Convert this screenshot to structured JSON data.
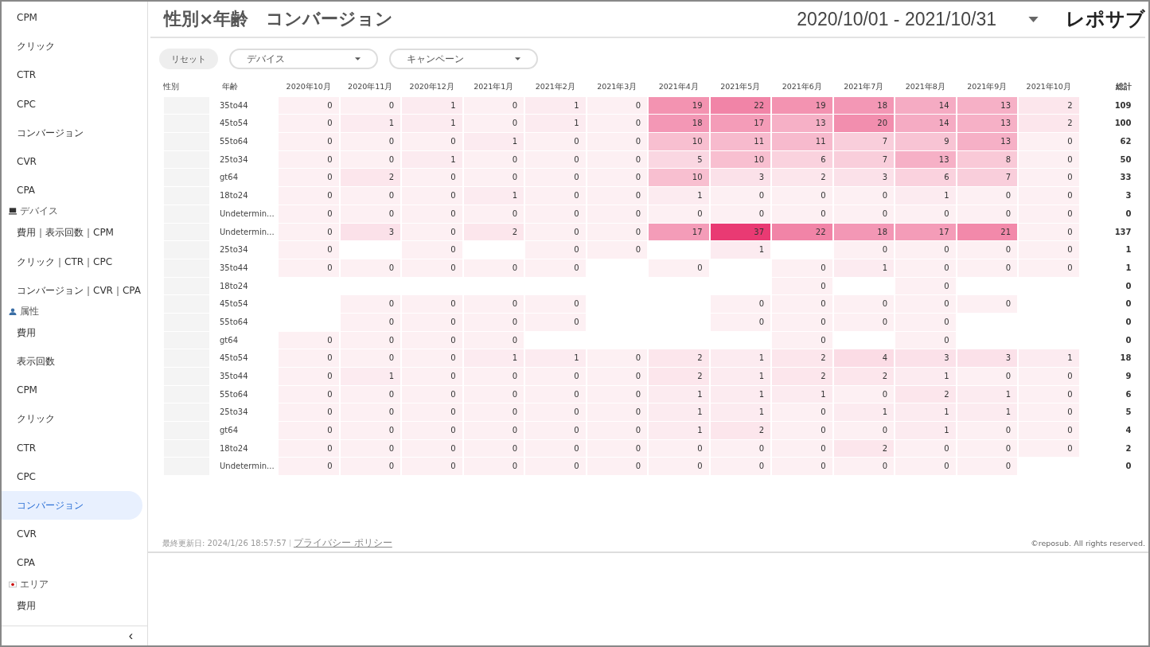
{
  "sidebar": {
    "entries": [
      {
        "kind": "item",
        "label": "CPM",
        "selected": false
      },
      {
        "kind": "item",
        "label": "クリック",
        "selected": false
      },
      {
        "kind": "item",
        "label": "CTR",
        "selected": false
      },
      {
        "kind": "item",
        "label": "CPC",
        "selected": false
      },
      {
        "kind": "item",
        "label": "コンバージョン",
        "selected": false
      },
      {
        "kind": "item",
        "label": "CVR",
        "selected": false
      },
      {
        "kind": "item",
        "label": "CPA",
        "selected": false
      },
      {
        "kind": "header",
        "label": "デバイス"
      },
      {
        "kind": "item",
        "label": "費用｜表示回数｜CPM",
        "selected": false
      },
      {
        "kind": "item",
        "label": "クリック｜CTR｜CPC",
        "selected": false
      },
      {
        "kind": "item",
        "label": "コンバージョン｜CVR｜CPA",
        "selected": false
      },
      {
        "kind": "header",
        "label": "属性"
      },
      {
        "kind": "item",
        "label": "費用",
        "selected": false
      },
      {
        "kind": "item",
        "label": "表示回数",
        "selected": false
      },
      {
        "kind": "item",
        "label": "CPM",
        "selected": false
      },
      {
        "kind": "item",
        "label": "クリック",
        "selected": false
      },
      {
        "kind": "item",
        "label": "CTR",
        "selected": false
      },
      {
        "kind": "item",
        "label": "CPC",
        "selected": false
      },
      {
        "kind": "item",
        "label": "コンバージョン",
        "selected": true
      },
      {
        "kind": "item",
        "label": "CVR",
        "selected": false
      },
      {
        "kind": "item",
        "label": "CPA",
        "selected": false
      },
      {
        "kind": "header",
        "label": "エリア"
      },
      {
        "kind": "item",
        "label": "費用",
        "selected": false
      }
    ],
    "collapse": "‹"
  },
  "header": {
    "title": "性別×年齢　コンバージョン",
    "date_range": "2020/10/01 - 2021/10/31",
    "logo": "レポサブ"
  },
  "filters": {
    "reset": "リセット",
    "dropdowns": [
      {
        "label": "デバイス"
      },
      {
        "label": "キャンペーン"
      }
    ]
  },
  "table": {
    "columns": [
      "性別",
      "年齢",
      "2020年10月",
      "2020年11月",
      "2020年12月",
      "2021年1月",
      "2021年2月",
      "2021年3月",
      "2021年4月",
      "2021年5月",
      "2021年6月",
      "2021年7月",
      "2021年8月",
      "2021年9月",
      "2021年10月",
      "総計"
    ],
    "rows": [
      {
        "age": "35to44",
        "total": "109",
        "cells": [
          {
            "kind": "value",
            "value": "0"
          },
          {
            "kind": "value",
            "value": "0"
          },
          {
            "kind": "value",
            "value": "1"
          },
          {
            "kind": "value",
            "value": "0"
          },
          {
            "kind": "value",
            "value": "1"
          },
          {
            "kind": "value",
            "value": "0"
          },
          {
            "kind": "value",
            "value": "19"
          },
          {
            "kind": "value",
            "value": "22"
          },
          {
            "kind": "value",
            "value": "19"
          },
          {
            "kind": "value",
            "value": "18"
          },
          {
            "kind": "value",
            "value": "14"
          },
          {
            "kind": "value",
            "value": "13"
          },
          {
            "kind": "value",
            "value": "2"
          }
        ]
      },
      {
        "age": "45to54",
        "total": "100",
        "cells": [
          {
            "kind": "value",
            "value": "0"
          },
          {
            "kind": "value",
            "value": "1"
          },
          {
            "kind": "value",
            "value": "1"
          },
          {
            "kind": "value",
            "value": "0"
          },
          {
            "kind": "value",
            "value": "1"
          },
          {
            "kind": "value",
            "value": "0"
          },
          {
            "kind": "value",
            "value": "18"
          },
          {
            "kind": "value",
            "value": "17"
          },
          {
            "kind": "value",
            "value": "13"
          },
          {
            "kind": "value",
            "value": "20"
          },
          {
            "kind": "value",
            "value": "14"
          },
          {
            "kind": "value",
            "value": "13"
          },
          {
            "kind": "value",
            "value": "2"
          }
        ]
      },
      {
        "age": "55to64",
        "total": "62",
        "cells": [
          {
            "kind": "value",
            "value": "0"
          },
          {
            "kind": "value",
            "value": "0"
          },
          {
            "kind": "value",
            "value": "0"
          },
          {
            "kind": "value",
            "value": "1"
          },
          {
            "kind": "value",
            "value": "0"
          },
          {
            "kind": "value",
            "value": "0"
          },
          {
            "kind": "value",
            "value": "10"
          },
          {
            "kind": "value",
            "value": "11"
          },
          {
            "kind": "value",
            "value": "11"
          },
          {
            "kind": "value",
            "value": "7"
          },
          {
            "kind": "value",
            "value": "9"
          },
          {
            "kind": "value",
            "value": "13"
          },
          {
            "kind": "value",
            "value": "0"
          }
        ]
      },
      {
        "age": "25to34",
        "total": "50",
        "cells": [
          {
            "kind": "value",
            "value": "0"
          },
          {
            "kind": "value",
            "value": "0"
          },
          {
            "kind": "value",
            "value": "1"
          },
          {
            "kind": "value",
            "value": "0"
          },
          {
            "kind": "value",
            "value": "0"
          },
          {
            "kind": "value",
            "value": "0"
          },
          {
            "kind": "value",
            "value": "5"
          },
          {
            "kind": "value",
            "value": "10"
          },
          {
            "kind": "value",
            "value": "6"
          },
          {
            "kind": "value",
            "value": "7"
          },
          {
            "kind": "value",
            "value": "13"
          },
          {
            "kind": "value",
            "value": "8"
          },
          {
            "kind": "value",
            "value": "0"
          }
        ]
      },
      {
        "age": "gt64",
        "total": "33",
        "cells": [
          {
            "kind": "value",
            "value": "0"
          },
          {
            "kind": "value",
            "value": "2"
          },
          {
            "kind": "value",
            "value": "0"
          },
          {
            "kind": "value",
            "value": "0"
          },
          {
            "kind": "value",
            "value": "0"
          },
          {
            "kind": "value",
            "value": "0"
          },
          {
            "kind": "value",
            "value": "10"
          },
          {
            "kind": "value",
            "value": "3"
          },
          {
            "kind": "value",
            "value": "2"
          },
          {
            "kind": "value",
            "value": "3"
          },
          {
            "kind": "value",
            "value": "6"
          },
          {
            "kind": "value",
            "value": "7"
          },
          {
            "kind": "value",
            "value": "0"
          }
        ]
      },
      {
        "age": "18to24",
        "total": "3",
        "cells": [
          {
            "kind": "value",
            "value": "0"
          },
          {
            "kind": "value",
            "value": "0"
          },
          {
            "kind": "value",
            "value": "0"
          },
          {
            "kind": "value",
            "value": "1"
          },
          {
            "kind": "value",
            "value": "0"
          },
          {
            "kind": "value",
            "value": "0"
          },
          {
            "kind": "value",
            "value": "1"
          },
          {
            "kind": "value",
            "value": "0"
          },
          {
            "kind": "value",
            "value": "0"
          },
          {
            "kind": "value",
            "value": "0"
          },
          {
            "kind": "value",
            "value": "1"
          },
          {
            "kind": "value",
            "value": "0"
          },
          {
            "kind": "value",
            "value": "0"
          }
        ]
      },
      {
        "age": "Undetermin...",
        "total": "0",
        "cells": [
          {
            "kind": "value",
            "value": "0"
          },
          {
            "kind": "value",
            "value": "0"
          },
          {
            "kind": "value",
            "value": "0"
          },
          {
            "kind": "value",
            "value": "0"
          },
          {
            "kind": "value",
            "value": "0"
          },
          {
            "kind": "value",
            "value": "0"
          },
          {
            "kind": "value",
            "value": "0"
          },
          {
            "kind": "value",
            "value": "0"
          },
          {
            "kind": "value",
            "value": "0"
          },
          {
            "kind": "value",
            "value": "0"
          },
          {
            "kind": "value",
            "value": "0"
          },
          {
            "kind": "value",
            "value": "0"
          },
          {
            "kind": "value",
            "value": "0"
          }
        ]
      },
      {
        "age": "Undetermin...",
        "total": "137",
        "cells": [
          {
            "kind": "value",
            "value": "0"
          },
          {
            "kind": "value",
            "value": "3"
          },
          {
            "kind": "value",
            "value": "0"
          },
          {
            "kind": "value",
            "value": "2"
          },
          {
            "kind": "value",
            "value": "0"
          },
          {
            "kind": "value",
            "value": "0"
          },
          {
            "kind": "value",
            "value": "17"
          },
          {
            "kind": "value",
            "value": "37"
          },
          {
            "kind": "value",
            "value": "22"
          },
          {
            "kind": "value",
            "value": "18"
          },
          {
            "kind": "value",
            "value": "17"
          },
          {
            "kind": "value",
            "value": "21"
          },
          {
            "kind": "value",
            "value": "0"
          }
        ]
      },
      {
        "age": "25to34",
        "total": "1",
        "cells": [
          {
            "kind": "value",
            "value": "0"
          },
          {
            "kind": "empty"
          },
          {
            "kind": "value",
            "value": "0"
          },
          {
            "kind": "empty"
          },
          {
            "kind": "value",
            "value": "0"
          },
          {
            "kind": "value",
            "value": "0"
          },
          {
            "kind": "empty"
          },
          {
            "kind": "value",
            "value": "1"
          },
          {
            "kind": "empty"
          },
          {
            "kind": "value",
            "value": "0"
          },
          {
            "kind": "value",
            "value": "0"
          },
          {
            "kind": "value",
            "value": "0"
          },
          {
            "kind": "value",
            "value": "0"
          }
        ]
      },
      {
        "age": "35to44",
        "total": "1",
        "cells": [
          {
            "kind": "value",
            "value": "0"
          },
          {
            "kind": "value",
            "value": "0"
          },
          {
            "kind": "value",
            "value": "0"
          },
          {
            "kind": "value",
            "value": "0"
          },
          {
            "kind": "value",
            "value": "0"
          },
          {
            "kind": "empty"
          },
          {
            "kind": "value",
            "value": "0"
          },
          {
            "kind": "empty"
          },
          {
            "kind": "value",
            "value": "0"
          },
          {
            "kind": "value",
            "value": "1"
          },
          {
            "kind": "value",
            "value": "0"
          },
          {
            "kind": "value",
            "value": "0"
          },
          {
            "kind": "value",
            "value": "0"
          }
        ]
      },
      {
        "age": "18to24",
        "total": "0",
        "cells": [
          {
            "kind": "empty"
          },
          {
            "kind": "empty"
          },
          {
            "kind": "empty"
          },
          {
            "kind": "empty"
          },
          {
            "kind": "empty"
          },
          {
            "kind": "empty"
          },
          {
            "kind": "empty"
          },
          {
            "kind": "empty"
          },
          {
            "kind": "value",
            "value": "0"
          },
          {
            "kind": "empty"
          },
          {
            "kind": "value",
            "value": "0"
          },
          {
            "kind": "empty"
          },
          {
            "kind": "empty"
          }
        ]
      },
      {
        "age": "45to54",
        "total": "0",
        "cells": [
          {
            "kind": "empty"
          },
          {
            "kind": "value",
            "value": "0"
          },
          {
            "kind": "value",
            "value": "0"
          },
          {
            "kind": "value",
            "value": "0"
          },
          {
            "kind": "value",
            "value": "0"
          },
          {
            "kind": "empty"
          },
          {
            "kind": "empty"
          },
          {
            "kind": "value",
            "value": "0"
          },
          {
            "kind": "value",
            "value": "0"
          },
          {
            "kind": "value",
            "value": "0"
          },
          {
            "kind": "value",
            "value": "0"
          },
          {
            "kind": "value",
            "value": "0"
          },
          {
            "kind": "empty"
          }
        ]
      },
      {
        "age": "55to64",
        "total": "0",
        "cells": [
          {
            "kind": "empty"
          },
          {
            "kind": "value",
            "value": "0"
          },
          {
            "kind": "value",
            "value": "0"
          },
          {
            "kind": "value",
            "value": "0"
          },
          {
            "kind": "value",
            "value": "0"
          },
          {
            "kind": "empty"
          },
          {
            "kind": "empty"
          },
          {
            "kind": "value",
            "value": "0"
          },
          {
            "kind": "value",
            "value": "0"
          },
          {
            "kind": "value",
            "value": "0"
          },
          {
            "kind": "value",
            "value": "0"
          },
          {
            "kind": "empty"
          },
          {
            "kind": "empty"
          }
        ]
      },
      {
        "age": "gt64",
        "total": "0",
        "cells": [
          {
            "kind": "value",
            "value": "0"
          },
          {
            "kind": "value",
            "value": "0"
          },
          {
            "kind": "value",
            "value": "0"
          },
          {
            "kind": "value",
            "value": "0"
          },
          {
            "kind": "empty"
          },
          {
            "kind": "empty"
          },
          {
            "kind": "empty"
          },
          {
            "kind": "empty"
          },
          {
            "kind": "value",
            "value": "0"
          },
          {
            "kind": "empty"
          },
          {
            "kind": "value",
            "value": "0"
          },
          {
            "kind": "empty"
          },
          {
            "kind": "empty"
          }
        ]
      },
      {
        "age": "45to54",
        "total": "18",
        "cells": [
          {
            "kind": "value",
            "value": "0"
          },
          {
            "kind": "value",
            "value": "0"
          },
          {
            "kind": "value",
            "value": "0"
          },
          {
            "kind": "value",
            "value": "1"
          },
          {
            "kind": "value",
            "value": "1"
          },
          {
            "kind": "value",
            "value": "0"
          },
          {
            "kind": "value",
            "value": "2"
          },
          {
            "kind": "value",
            "value": "1"
          },
          {
            "kind": "value",
            "value": "2"
          },
          {
            "kind": "value",
            "value": "4"
          },
          {
            "kind": "value",
            "value": "3"
          },
          {
            "kind": "value",
            "value": "3"
          },
          {
            "kind": "value",
            "value": "1"
          }
        ]
      },
      {
        "age": "35to44",
        "total": "9",
        "cells": [
          {
            "kind": "value",
            "value": "0"
          },
          {
            "kind": "value",
            "value": "1"
          },
          {
            "kind": "value",
            "value": "0"
          },
          {
            "kind": "value",
            "value": "0"
          },
          {
            "kind": "value",
            "value": "0"
          },
          {
            "kind": "value",
            "value": "0"
          },
          {
            "kind": "value",
            "value": "2"
          },
          {
            "kind": "value",
            "value": "1"
          },
          {
            "kind": "value",
            "value": "2"
          },
          {
            "kind": "value",
            "value": "2"
          },
          {
            "kind": "value",
            "value": "1"
          },
          {
            "kind": "value",
            "value": "0"
          },
          {
            "kind": "value",
            "value": "0"
          }
        ]
      },
      {
        "age": "55to64",
        "total": "6",
        "cells": [
          {
            "kind": "value",
            "value": "0"
          },
          {
            "kind": "value",
            "value": "0"
          },
          {
            "kind": "value",
            "value": "0"
          },
          {
            "kind": "value",
            "value": "0"
          },
          {
            "kind": "value",
            "value": "0"
          },
          {
            "kind": "value",
            "value": "0"
          },
          {
            "kind": "value",
            "value": "1"
          },
          {
            "kind": "value",
            "value": "1"
          },
          {
            "kind": "value",
            "value": "1"
          },
          {
            "kind": "value",
            "value": "0"
          },
          {
            "kind": "value",
            "value": "2"
          },
          {
            "kind": "value",
            "value": "1"
          },
          {
            "kind": "value",
            "value": "0"
          }
        ]
      },
      {
        "age": "25to34",
        "total": "5",
        "cells": [
          {
            "kind": "value",
            "value": "0"
          },
          {
            "kind": "value",
            "value": "0"
          },
          {
            "kind": "value",
            "value": "0"
          },
          {
            "kind": "value",
            "value": "0"
          },
          {
            "kind": "value",
            "value": "0"
          },
          {
            "kind": "value",
            "value": "0"
          },
          {
            "kind": "value",
            "value": "1"
          },
          {
            "kind": "value",
            "value": "1"
          },
          {
            "kind": "value",
            "value": "0"
          },
          {
            "kind": "value",
            "value": "1"
          },
          {
            "kind": "value",
            "value": "1"
          },
          {
            "kind": "value",
            "value": "1"
          },
          {
            "kind": "value",
            "value": "0"
          }
        ]
      },
      {
        "age": "gt64",
        "total": "4",
        "cells": [
          {
            "kind": "value",
            "value": "0"
          },
          {
            "kind": "value",
            "value": "0"
          },
          {
            "kind": "value",
            "value": "0"
          },
          {
            "kind": "value",
            "value": "0"
          },
          {
            "kind": "value",
            "value": "0"
          },
          {
            "kind": "value",
            "value": "0"
          },
          {
            "kind": "value",
            "value": "1"
          },
          {
            "kind": "value",
            "value": "2"
          },
          {
            "kind": "value",
            "value": "0"
          },
          {
            "kind": "value",
            "value": "0"
          },
          {
            "kind": "value",
            "value": "1"
          },
          {
            "kind": "value",
            "value": "0"
          },
          {
            "kind": "value",
            "value": "0"
          }
        ]
      },
      {
        "age": "18to24",
        "total": "2",
        "cells": [
          {
            "kind": "value",
            "value": "0"
          },
          {
            "kind": "value",
            "value": "0"
          },
          {
            "kind": "value",
            "value": "0"
          },
          {
            "kind": "value",
            "value": "0"
          },
          {
            "kind": "value",
            "value": "0"
          },
          {
            "kind": "value",
            "value": "0"
          },
          {
            "kind": "value",
            "value": "0"
          },
          {
            "kind": "value",
            "value": "0"
          },
          {
            "kind": "value",
            "value": "0"
          },
          {
            "kind": "value",
            "value": "2"
          },
          {
            "kind": "value",
            "value": "0"
          },
          {
            "kind": "value",
            "value": "0"
          },
          {
            "kind": "value",
            "value": "0"
          }
        ]
      },
      {
        "age": "Undetermin...",
        "total": "0",
        "cells": [
          {
            "kind": "value",
            "value": "0"
          },
          {
            "kind": "value",
            "value": "0"
          },
          {
            "kind": "value",
            "value": "0"
          },
          {
            "kind": "value",
            "value": "0"
          },
          {
            "kind": "value",
            "value": "0"
          },
          {
            "kind": "value",
            "value": "0"
          },
          {
            "kind": "value",
            "value": "0"
          },
          {
            "kind": "value",
            "value": "0"
          },
          {
            "kind": "value",
            "value": "0"
          },
          {
            "kind": "value",
            "value": "0"
          },
          {
            "kind": "value",
            "value": "0"
          },
          {
            "kind": "value",
            "value": "0"
          },
          {
            "kind": "empty"
          }
        ]
      }
    ]
  },
  "footer": {
    "updated": "最終更新日: 2024/1/26 18:57:57",
    "privacy_link": "プライバシー ポリシー",
    "copyright": "©reposub. All rights reserved."
  }
}
